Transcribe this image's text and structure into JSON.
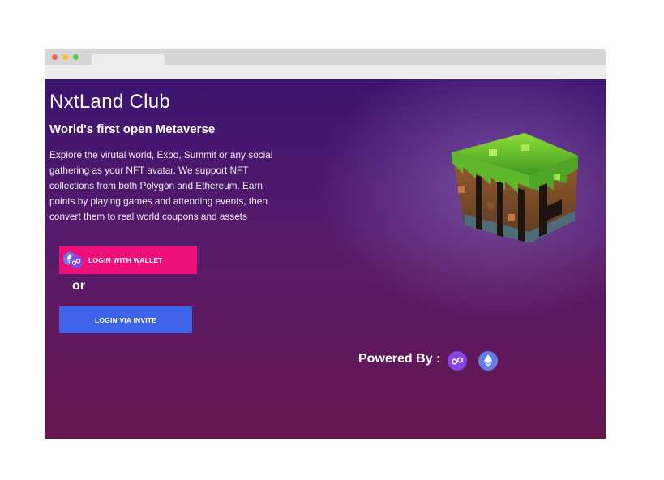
{
  "hero": {
    "title": "NxtLand Club",
    "subtitle": "World's first open Metaverse",
    "description": "Explore the virutal world, Expo, Summit or any social gathering as your NFT avatar. We support NFT collections from both Polygon and Ethereum. Earn points by playing games and attending events, then convert them to real world coupons and assets"
  },
  "actions": {
    "wallet_label": "LOGIN WITH WALLET",
    "or_label": "or",
    "invite_label": "LOGIN VIA INVITE"
  },
  "footer": {
    "powered_by": "Powered By :",
    "chains": [
      "polygon-icon",
      "ethereum-icon"
    ]
  },
  "colors": {
    "wallet_button": "#ee0f78",
    "invite_button": "#3e63ea",
    "background_top": "#3b1470",
    "background_bottom": "#66174f",
    "polygon": "#8247e5",
    "ethereum": "#627eea"
  }
}
